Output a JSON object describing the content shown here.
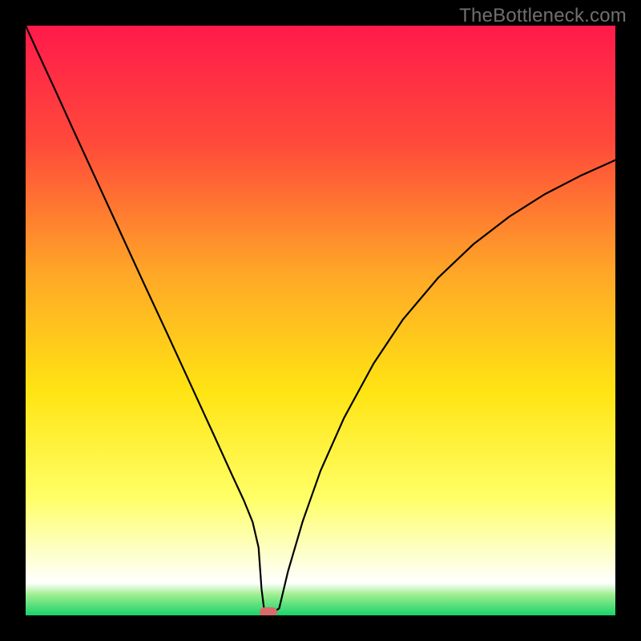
{
  "watermark": "TheBottleneck.com",
  "marker_color": "#d86a6a",
  "chart_data": {
    "type": "line",
    "title": "",
    "xlabel": "",
    "ylabel": "",
    "xlim": [
      0,
      100
    ],
    "ylim": [
      0,
      100
    ],
    "grid": false,
    "legend": false,
    "gradient_stops": [
      {
        "pos": 0.0,
        "color": "#ff1a4b"
      },
      {
        "pos": 0.2,
        "color": "#ff4a3a"
      },
      {
        "pos": 0.42,
        "color": "#ffa727"
      },
      {
        "pos": 0.62,
        "color": "#ffe413"
      },
      {
        "pos": 0.8,
        "color": "#ffff66"
      },
      {
        "pos": 0.9,
        "color": "#fdffcf"
      },
      {
        "pos": 0.945,
        "color": "#ffffff"
      },
      {
        "pos": 0.965,
        "color": "#9eee90"
      },
      {
        "pos": 1.0,
        "color": "#18d36a"
      }
    ],
    "series": [
      {
        "name": "curve",
        "color": "#000000",
        "x": [
          0,
          2,
          5,
          8,
          12,
          16,
          20,
          24,
          28,
          32,
          35,
          37,
          38.5,
          39.5,
          40,
          40.5,
          42,
          43,
          44.5,
          47,
          50,
          54,
          59,
          64,
          70,
          76,
          82,
          88,
          94,
          100
        ],
        "y": [
          100,
          95.6,
          89.1,
          82.5,
          73.8,
          65.1,
          56.4,
          47.8,
          39.1,
          30.4,
          23.8,
          19.5,
          15.8,
          11.5,
          4.5,
          0.5,
          0.5,
          1.2,
          7.5,
          16.0,
          24.5,
          33.5,
          42.7,
          50.2,
          57.3,
          63.0,
          67.6,
          71.4,
          74.5,
          77.2
        ]
      }
    ],
    "minimum_marker": {
      "x": 41.2,
      "y": 0.5
    }
  }
}
